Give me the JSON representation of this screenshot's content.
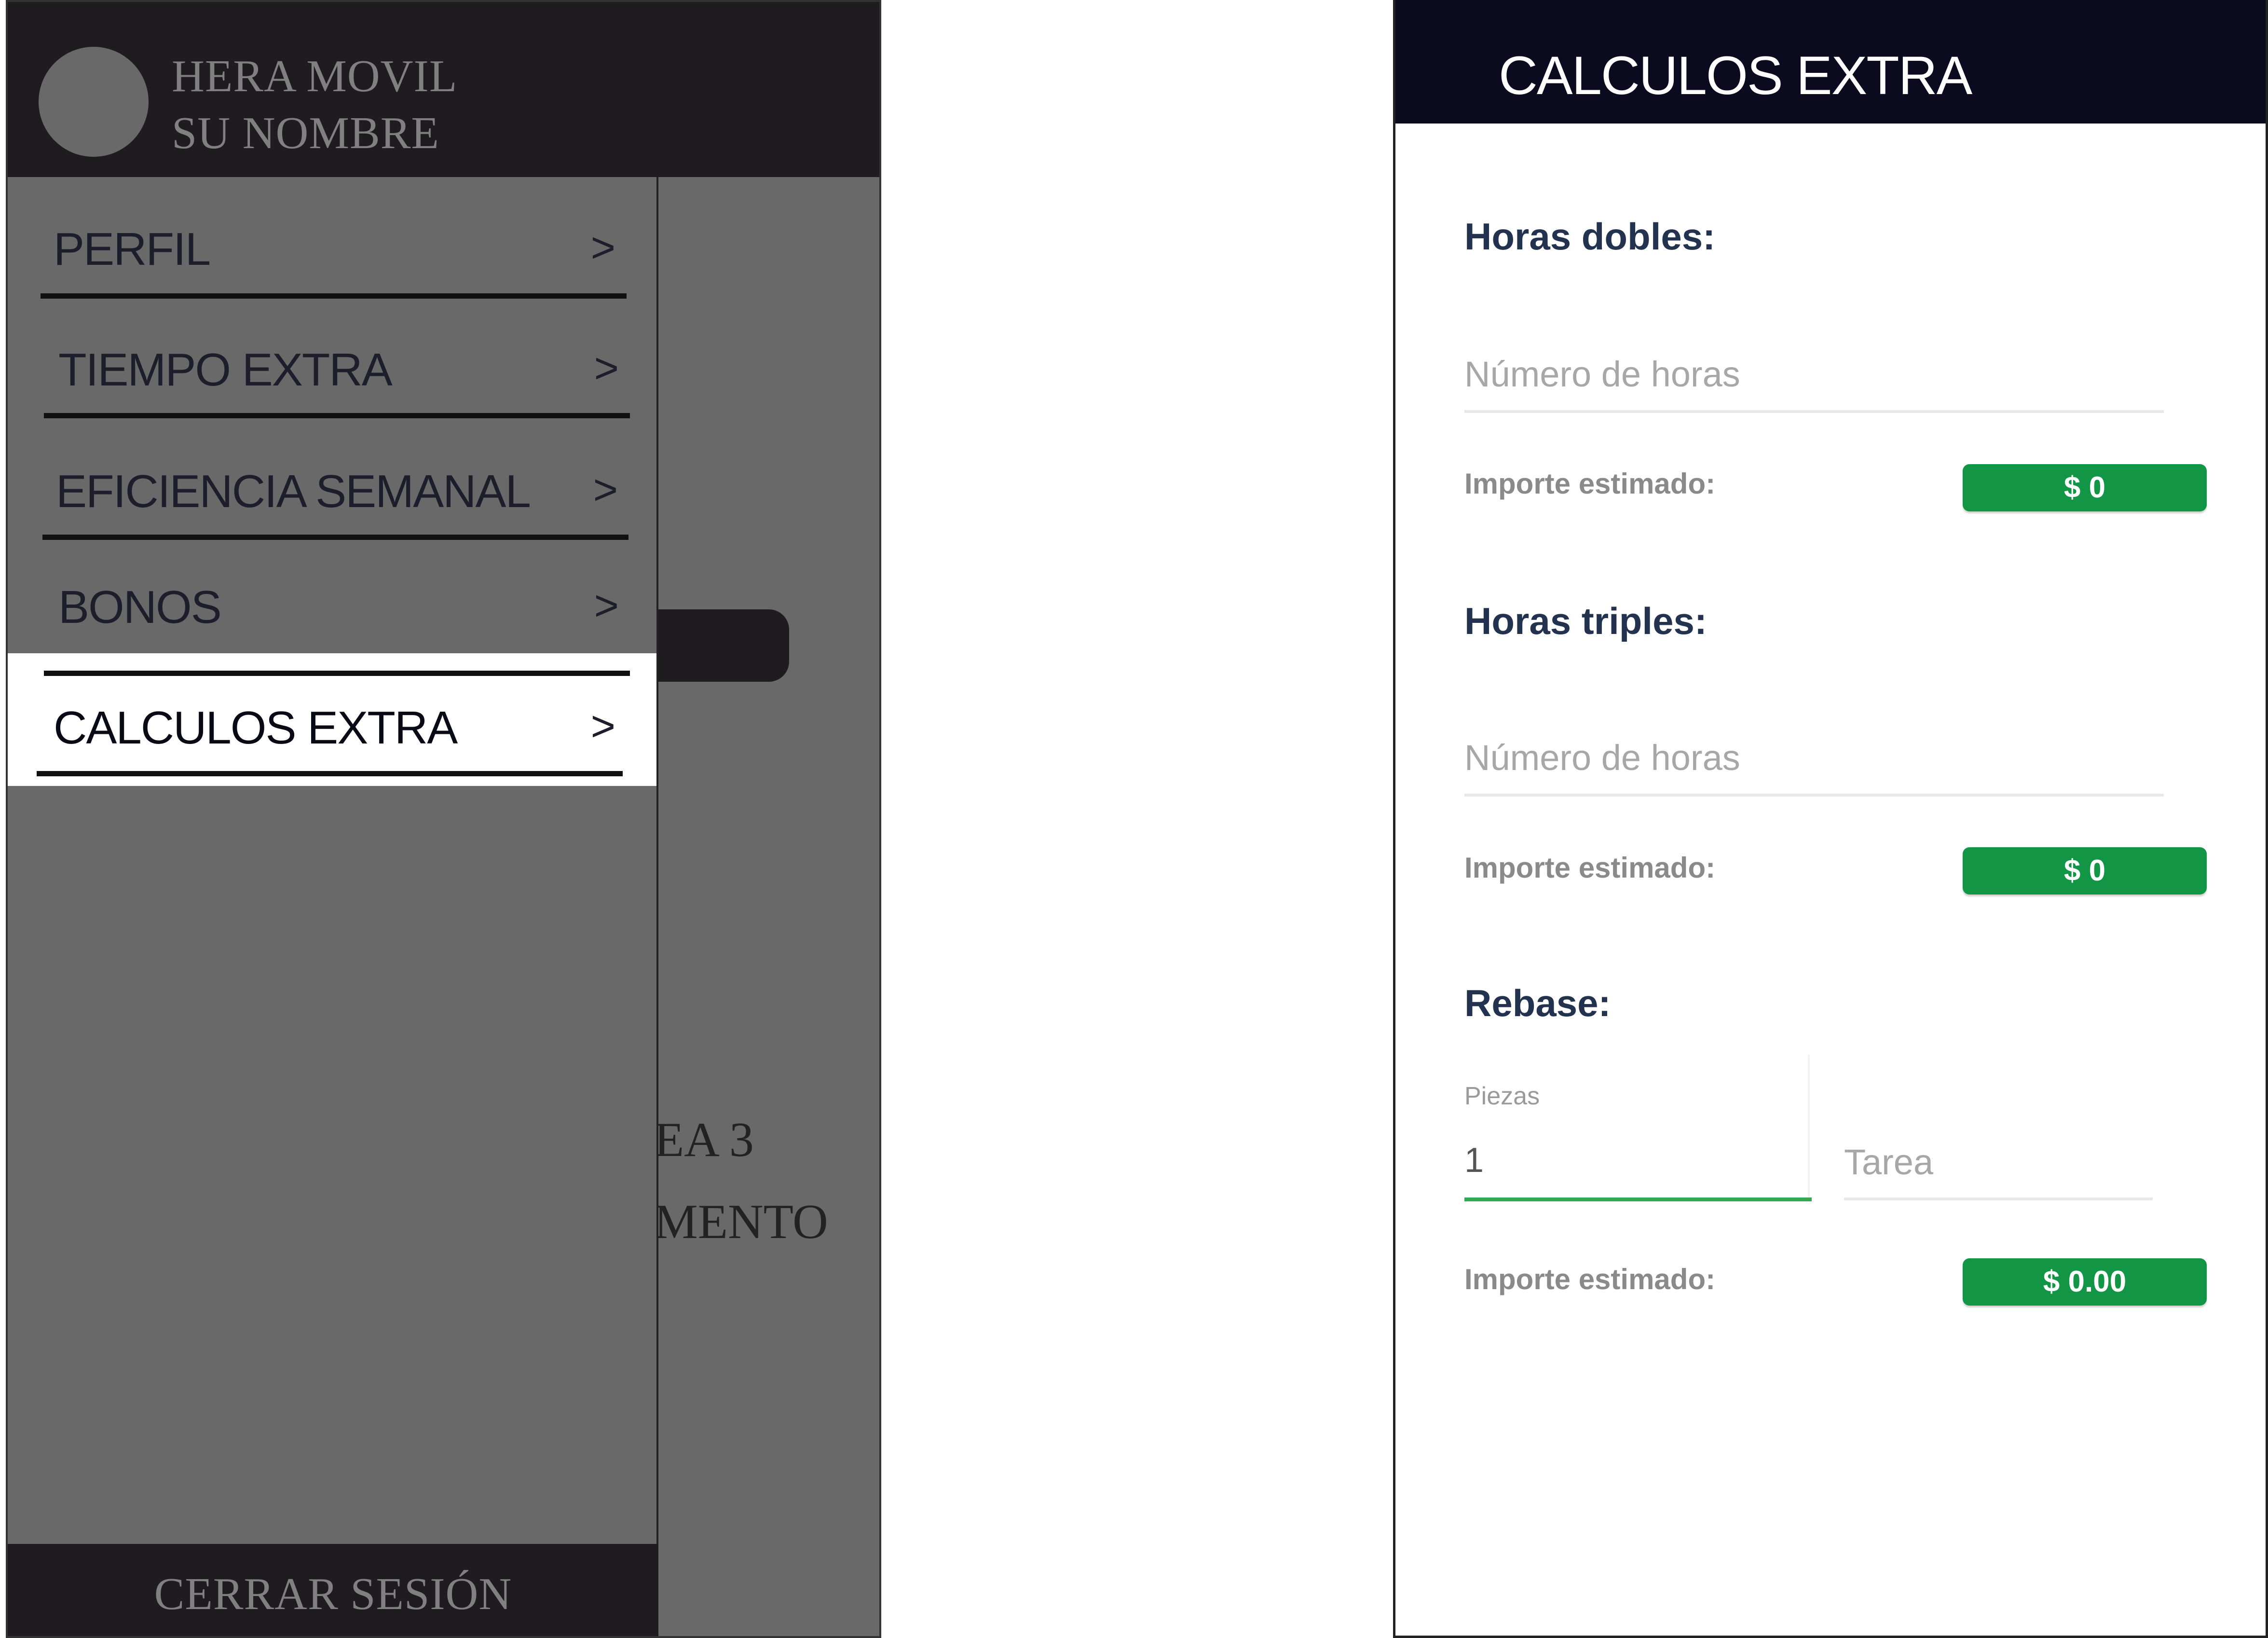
{
  "drawer": {
    "app_name": "HERA  MOVIL",
    "user_name": "SU NOMBRE",
    "menu": [
      {
        "label": "PERFIL",
        "arrow": ">"
      },
      {
        "label": "TIEMPO EXTRA",
        "arrow": ">"
      },
      {
        "label": "EFICIENCIA SEMANAL",
        "arrow": ">"
      },
      {
        "label": "BONOS",
        "arrow": ">"
      },
      {
        "label": "CALCULOS EXTRA",
        "arrow": ">",
        "active": true
      }
    ],
    "logout_label": "CERRAR SESIÓN",
    "background_text": [
      "EA 3",
      "MENTO"
    ]
  },
  "calculator": {
    "title": "CALCULOS EXTRA",
    "horas_dobles": {
      "title": "Horas dobles:",
      "placeholder": "Número de horas",
      "estimate_label": "Importe estimado:",
      "estimate_value": "$ 0"
    },
    "horas_triples": {
      "title": "Horas triples:",
      "placeholder": "Número de horas",
      "estimate_label": "Importe estimado:",
      "estimate_value": "$ 0"
    },
    "rebase": {
      "title": "Rebase:",
      "piezas_label": "Piezas",
      "piezas_value": "1",
      "tarea_placeholder": "Tarea",
      "estimate_label": "Importe estimado:",
      "estimate_value": "$ 0.00"
    }
  },
  "colors": {
    "drawer_header": "#1f1c20",
    "drawer_body": "#696969",
    "app_bar": "#0c0a1f",
    "accent_green": "#129545",
    "focus_green": "#34a853",
    "section_title": "#23324f"
  }
}
